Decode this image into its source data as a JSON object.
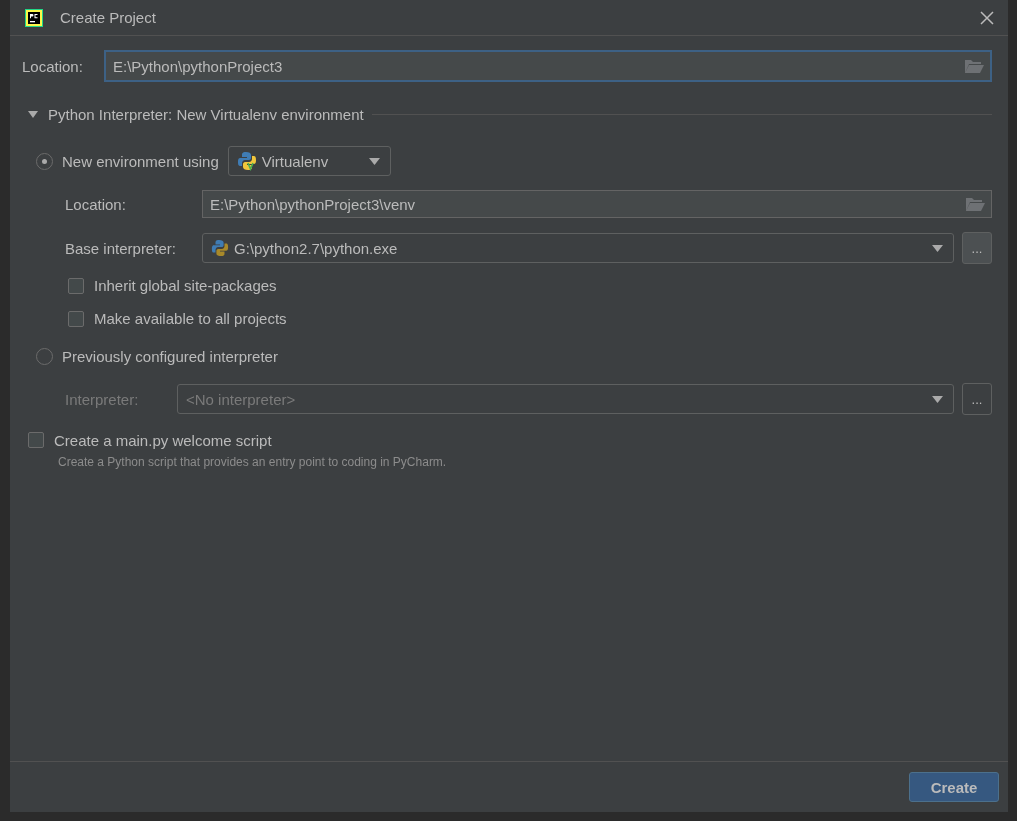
{
  "window": {
    "title": "Create Project"
  },
  "location": {
    "label": "Location:",
    "value": "E:\\Python\\pythonProject3",
    "focused": true
  },
  "section": {
    "title": "Python Interpreter: New Virtualenv environment",
    "expanded": true
  },
  "new_environment": {
    "label": "New environment using",
    "selected": true,
    "tool": "Virtualenv",
    "location_label": "Location:",
    "location": "E:\\Python\\pythonProject3\\venv",
    "base_label": "Base interpreter:",
    "base_interpreter": "G:\\python2.7\\python.exe",
    "browse": "...",
    "options": [
      {
        "label": "Inherit global site-packages",
        "checked": false
      },
      {
        "label": "Make available to all projects",
        "checked": false
      }
    ]
  },
  "previous": {
    "label": "Previously configured interpreter",
    "selected": false,
    "interpreter_label": "Interpreter:",
    "interpreter": "<No interpreter>",
    "browse": "..."
  },
  "welcome_script": {
    "label": "Create a main.py welcome script",
    "checked": false,
    "description": "Create a Python script that provides an entry point to coding in PyCharm."
  },
  "buttons": [
    {
      "label": "Create",
      "primary": true
    }
  ]
}
